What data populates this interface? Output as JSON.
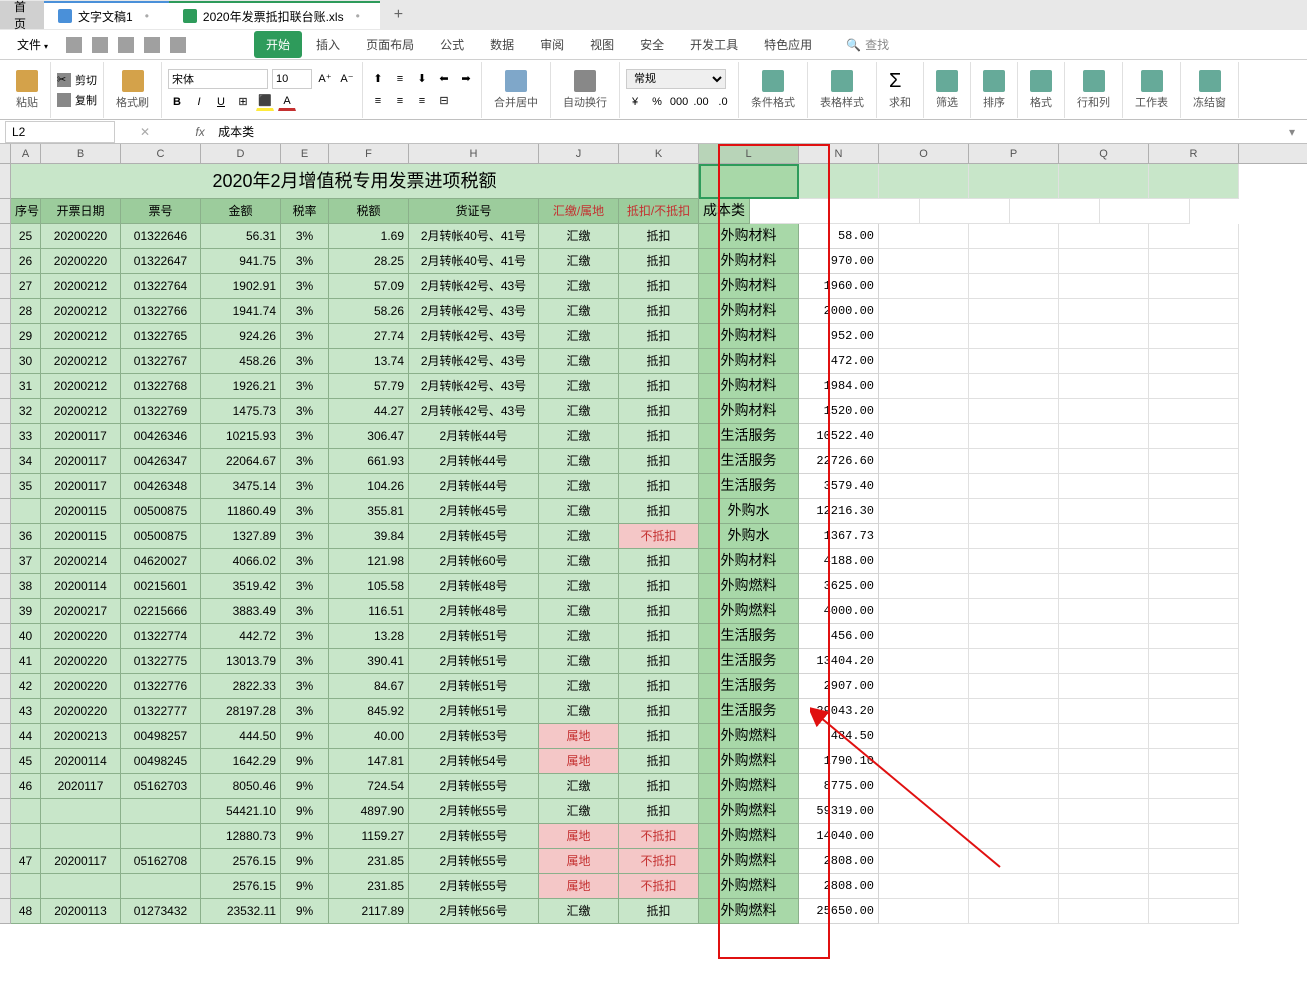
{
  "tabs": {
    "home": "首页",
    "doc": "文字文稿1",
    "xls": "2020年发票抵扣联台账.xls"
  },
  "menu": {
    "file": "文件",
    "start": "开始",
    "insert": "插入",
    "layout": "页面布局",
    "formula": "公式",
    "data": "数据",
    "review": "审阅",
    "view": "视图",
    "security": "安全",
    "dev": "开发工具",
    "special": "特色应用",
    "search": "查找"
  },
  "toolbar": {
    "paste": "粘贴",
    "cut": "剪切",
    "copy": "复制",
    "format_painter": "格式刷",
    "font": "宋体",
    "size": "10",
    "merge": "合并居中",
    "wrap": "自动换行",
    "num_format": "常规",
    "cond_format": "条件格式",
    "table_style": "表格样式",
    "sum": "求和",
    "filter": "筛选",
    "sort": "排序",
    "format": "格式",
    "rowcol": "行和列",
    "sheet": "工作表",
    "freeze": "冻结窗"
  },
  "namebox": "L2",
  "formula": "成本类",
  "title_merged": "2020年2月增值税专用发票进项税额",
  "headers": {
    "A": "序号",
    "B": "开票日期",
    "C": "票号",
    "D": "金额",
    "E": "税率",
    "F": "税额",
    "H": "货证号",
    "J": "汇缴/属地",
    "K": "抵扣/不抵扣",
    "L": "成本类"
  },
  "col_letters": [
    "A",
    "B",
    "C",
    "D",
    "E",
    "F",
    "H",
    "J",
    "K",
    "L",
    "N",
    "O",
    "P",
    "Q",
    "R"
  ],
  "rows": [
    {
      "a": "25",
      "b": "20200220",
      "c": "01322646",
      "d": "56.31",
      "e": "3%",
      "f": "1.69",
      "h": "2月转帐40号、41号",
      "j": "汇缴",
      "k": "抵扣",
      "l": "外购材料",
      "n": "58.00"
    },
    {
      "a": "26",
      "b": "20200220",
      "c": "01322647",
      "d": "941.75",
      "e": "3%",
      "f": "28.25",
      "h": "2月转帐40号、41号",
      "j": "汇缴",
      "k": "抵扣",
      "l": "外购材料",
      "n": "970.00"
    },
    {
      "a": "27",
      "b": "20200212",
      "c": "01322764",
      "d": "1902.91",
      "e": "3%",
      "f": "57.09",
      "h": "2月转帐42号、43号",
      "j": "汇缴",
      "k": "抵扣",
      "l": "外购材料",
      "n": "1960.00"
    },
    {
      "a": "28",
      "b": "20200212",
      "c": "01322766",
      "d": "1941.74",
      "e": "3%",
      "f": "58.26",
      "h": "2月转帐42号、43号",
      "j": "汇缴",
      "k": "抵扣",
      "l": "外购材料",
      "n": "2000.00"
    },
    {
      "a": "29",
      "b": "20200212",
      "c": "01322765",
      "d": "924.26",
      "e": "3%",
      "f": "27.74",
      "h": "2月转帐42号、43号",
      "j": "汇缴",
      "k": "抵扣",
      "l": "外购材料",
      "n": "952.00"
    },
    {
      "a": "30",
      "b": "20200212",
      "c": "01322767",
      "d": "458.26",
      "e": "3%",
      "f": "13.74",
      "h": "2月转帐42号、43号",
      "j": "汇缴",
      "k": "抵扣",
      "l": "外购材料",
      "n": "472.00"
    },
    {
      "a": "31",
      "b": "20200212",
      "c": "01322768",
      "d": "1926.21",
      "e": "3%",
      "f": "57.79",
      "h": "2月转帐42号、43号",
      "j": "汇缴",
      "k": "抵扣",
      "l": "外购材料",
      "n": "1984.00"
    },
    {
      "a": "32",
      "b": "20200212",
      "c": "01322769",
      "d": "1475.73",
      "e": "3%",
      "f": "44.27",
      "h": "2月转帐42号、43号",
      "j": "汇缴",
      "k": "抵扣",
      "l": "外购材料",
      "n": "1520.00"
    },
    {
      "a": "33",
      "b": "20200117",
      "c": "00426346",
      "d": "10215.93",
      "e": "3%",
      "f": "306.47",
      "h": "2月转帐44号",
      "j": "汇缴",
      "k": "抵扣",
      "l": "生活服务",
      "n": "10522.40"
    },
    {
      "a": "34",
      "b": "20200117",
      "c": "00426347",
      "d": "22064.67",
      "e": "3%",
      "f": "661.93",
      "h": "2月转帐44号",
      "j": "汇缴",
      "k": "抵扣",
      "l": "生活服务",
      "n": "22726.60"
    },
    {
      "a": "35",
      "b": "20200117",
      "c": "00426348",
      "d": "3475.14",
      "e": "3%",
      "f": "104.26",
      "h": "2月转帐44号",
      "j": "汇缴",
      "k": "抵扣",
      "l": "生活服务",
      "n": "3579.40"
    },
    {
      "a": "",
      "b": "20200115",
      "c": "00500875",
      "d": "11860.49",
      "e": "3%",
      "f": "355.81",
      "h": "2月转帐45号",
      "j": "汇缴",
      "k": "抵扣",
      "l": "外购水",
      "n": "12216.30"
    },
    {
      "a": "36",
      "b": "20200115",
      "c": "00500875",
      "d": "1327.89",
      "e": "3%",
      "f": "39.84",
      "h": "2月转帐45号",
      "j": "汇缴",
      "k": "不抵扣",
      "kpink": true,
      "l": "外购水",
      "n": "1367.73"
    },
    {
      "a": "37",
      "b": "20200214",
      "c": "04620027",
      "d": "4066.02",
      "e": "3%",
      "f": "121.98",
      "h": "2月转帐60号",
      "j": "汇缴",
      "k": "抵扣",
      "l": "外购材料",
      "n": "4188.00"
    },
    {
      "a": "38",
      "b": "20200114",
      "c": "00215601",
      "d": "3519.42",
      "e": "3%",
      "f": "105.58",
      "h": "2月转帐48号",
      "j": "汇缴",
      "k": "抵扣",
      "l": "外购燃料",
      "n": "3625.00"
    },
    {
      "a": "39",
      "b": "20200217",
      "c": "02215666",
      "d": "3883.49",
      "e": "3%",
      "f": "116.51",
      "h": "2月转帐48号",
      "j": "汇缴",
      "k": "抵扣",
      "l": "外购燃料",
      "n": "4000.00"
    },
    {
      "a": "40",
      "b": "20200220",
      "c": "01322774",
      "d": "442.72",
      "e": "3%",
      "f": "13.28",
      "h": "2月转帐51号",
      "j": "汇缴",
      "k": "抵扣",
      "l": "生活服务",
      "n": "456.00"
    },
    {
      "a": "41",
      "b": "20200220",
      "c": "01322775",
      "d": "13013.79",
      "e": "3%",
      "f": "390.41",
      "h": "2月转帐51号",
      "j": "汇缴",
      "k": "抵扣",
      "l": "生活服务",
      "n": "13404.20"
    },
    {
      "a": "42",
      "b": "20200220",
      "c": "01322776",
      "d": "2822.33",
      "e": "3%",
      "f": "84.67",
      "h": "2月转帐51号",
      "j": "汇缴",
      "k": "抵扣",
      "l": "生活服务",
      "n": "2907.00"
    },
    {
      "a": "43",
      "b": "20200220",
      "c": "01322777",
      "d": "28197.28",
      "e": "3%",
      "f": "845.92",
      "h": "2月转帐51号",
      "j": "汇缴",
      "k": "抵扣",
      "l": "生活服务",
      "n": "29043.20"
    },
    {
      "a": "44",
      "b": "20200213",
      "c": "00498257",
      "d": "444.50",
      "e": "9%",
      "f": "40.00",
      "h": "2月转帐53号",
      "j": "属地",
      "jpink": true,
      "k": "抵扣",
      "l": "外购燃料",
      "n": "484.50"
    },
    {
      "a": "45",
      "b": "20200114",
      "c": "00498245",
      "d": "1642.29",
      "e": "9%",
      "f": "147.81",
      "h": "2月转帐54号",
      "j": "属地",
      "jpink": true,
      "k": "抵扣",
      "l": "外购燃料",
      "n": "1790.10"
    },
    {
      "a": "46",
      "b": "2020117",
      "c": "05162703",
      "d": "8050.46",
      "e": "9%",
      "f": "724.54",
      "h": "2月转帐55号",
      "j": "汇缴",
      "k": "抵扣",
      "l": "外购燃料",
      "n": "8775.00"
    },
    {
      "a": "",
      "b": "",
      "c": "",
      "d": "54421.10",
      "e": "9%",
      "f": "4897.90",
      "h": "2月转帐55号",
      "j": "汇缴",
      "k": "抵扣",
      "l": "外购燃料",
      "n": "59319.00"
    },
    {
      "a": "",
      "b": "",
      "c": "",
      "d": "12880.73",
      "e": "9%",
      "f": "1159.27",
      "h": "2月转帐55号",
      "j": "属地",
      "jpink": true,
      "k": "不抵扣",
      "kpink": true,
      "l": "外购燃料",
      "n": "14040.00"
    },
    {
      "a": "47",
      "b": "20200117",
      "c": "05162708",
      "d": "2576.15",
      "e": "9%",
      "f": "231.85",
      "h": "2月转帐55号",
      "j": "属地",
      "jpink": true,
      "k": "不抵扣",
      "kpink": true,
      "l": "外购燃料",
      "n": "2808.00"
    },
    {
      "a": "",
      "b": "",
      "c": "",
      "d": "2576.15",
      "e": "9%",
      "f": "231.85",
      "h": "2月转帐55号",
      "j": "属地",
      "jpink": true,
      "k": "不抵扣",
      "kpink": true,
      "l": "外购燃料",
      "n": "2808.00"
    },
    {
      "a": "48",
      "b": "20200113",
      "c": "01273432",
      "d": "23532.11",
      "e": "9%",
      "f": "2117.89",
      "h": "2月转帐56号",
      "j": "汇缴",
      "k": "抵扣",
      "l": "外购燃料",
      "n": "25650.00"
    }
  ]
}
